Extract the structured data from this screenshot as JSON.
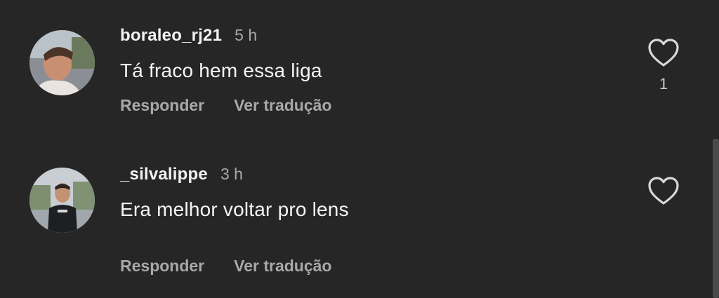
{
  "comments": [
    {
      "username": "boraleo_rj21",
      "time": "5 h",
      "text": "Tá fraco hem essa liga",
      "reply_label": "Responder",
      "translate_label": "Ver tradução",
      "like_count": "1"
    },
    {
      "username": "_silvalippe",
      "time": "3 h",
      "text": "Era melhor voltar pro lens",
      "reply_label": "Responder",
      "translate_label": "Ver tradução"
    }
  ],
  "icons": {
    "like": "heart-outline-icon"
  },
  "colors": {
    "background": "#262626",
    "primary_text": "#f5f5f5",
    "secondary_text": "#a8a8a8"
  }
}
